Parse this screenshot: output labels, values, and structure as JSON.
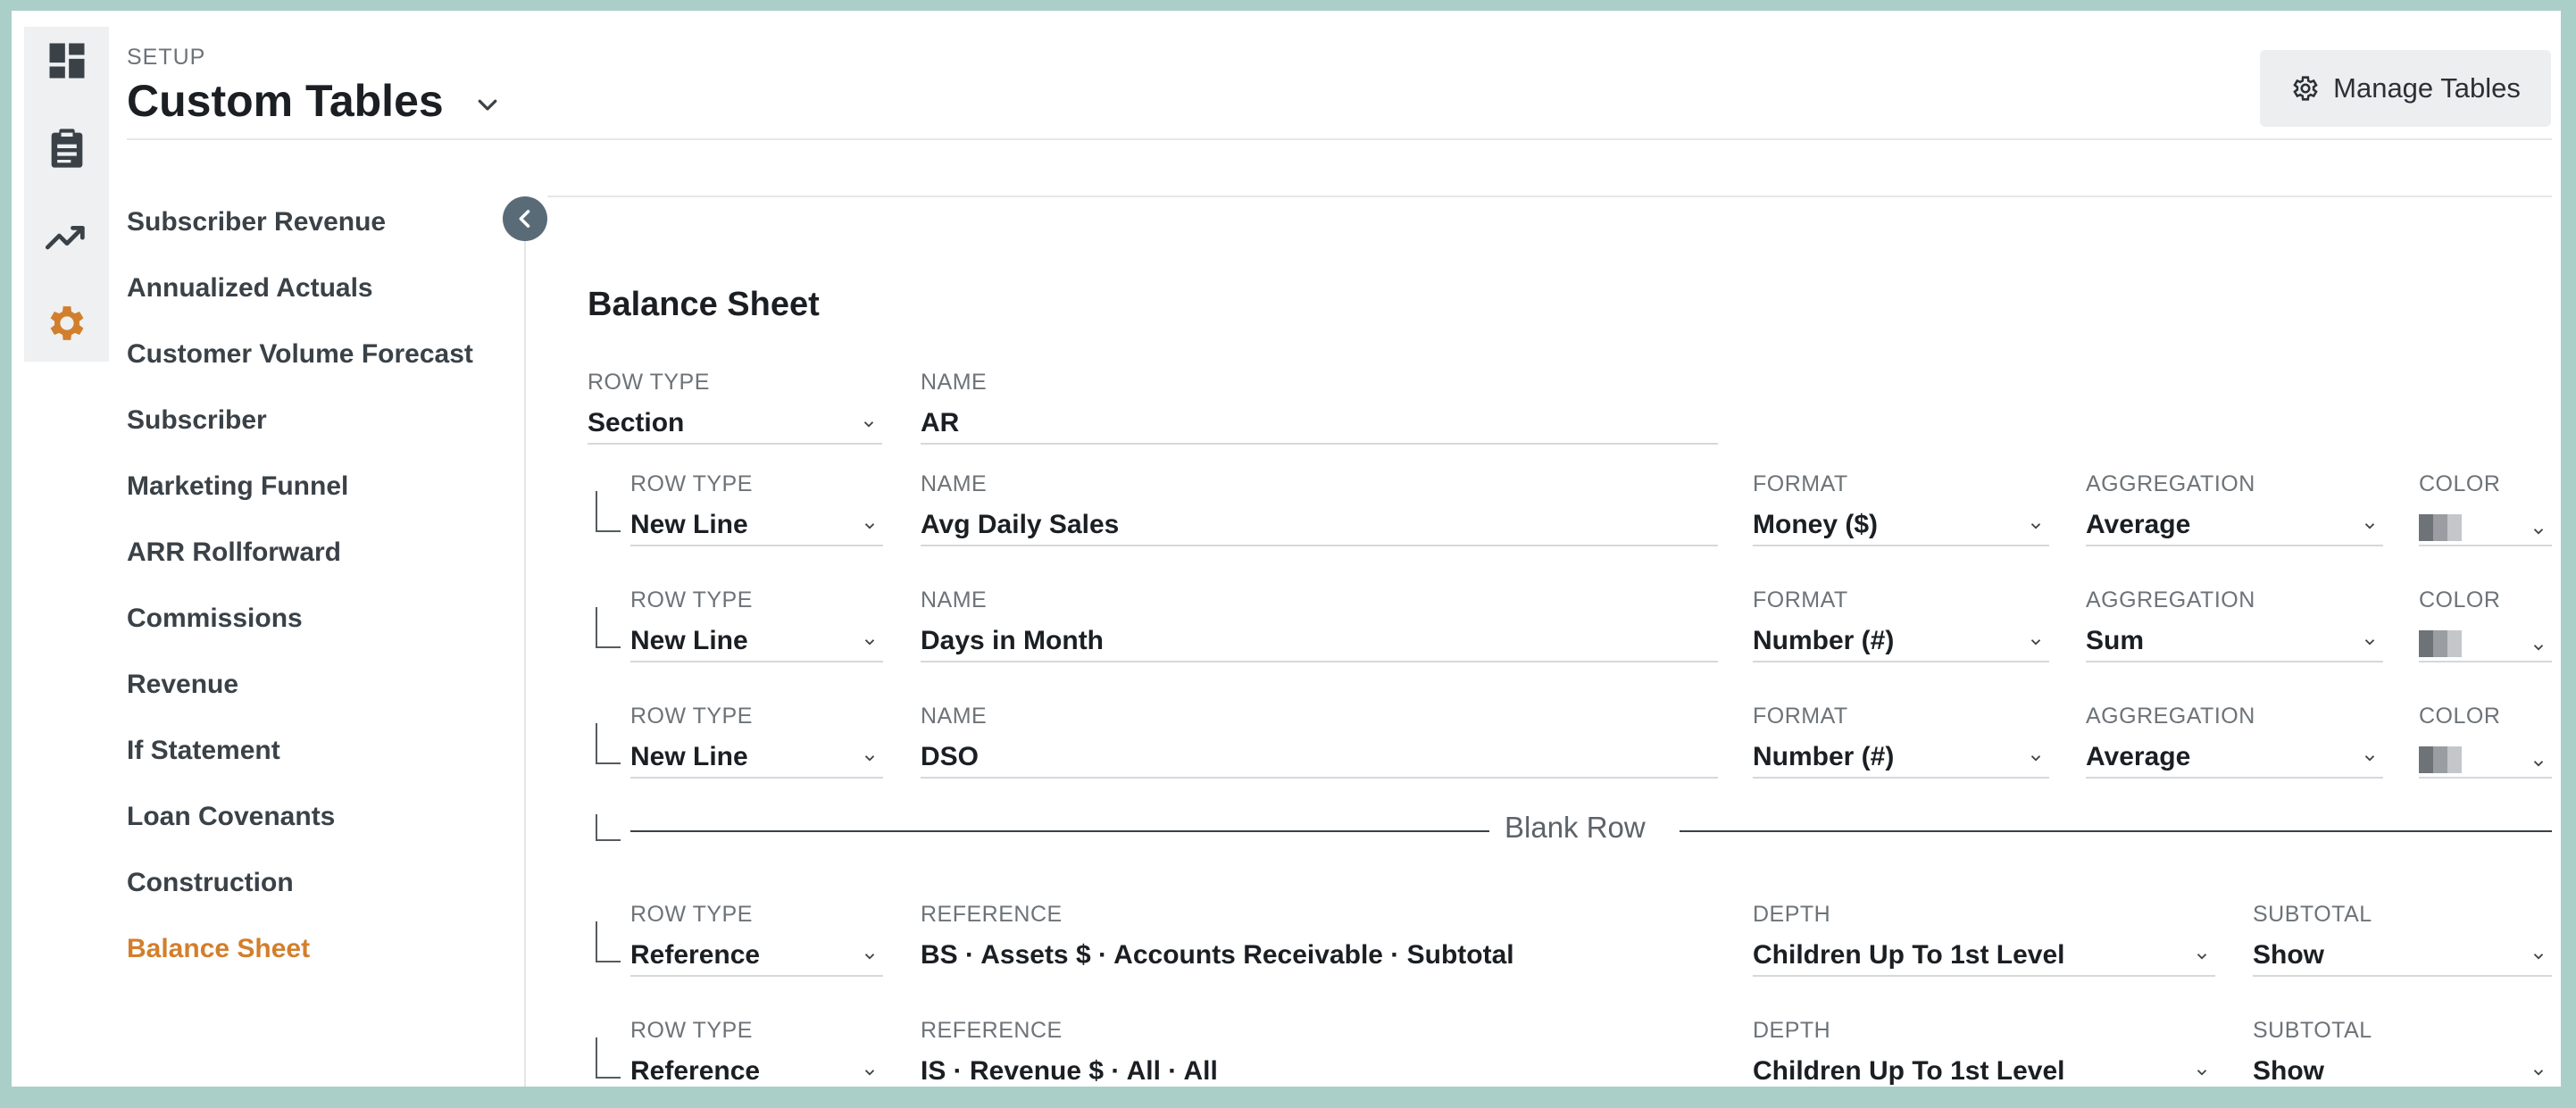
{
  "rail": {
    "icons": [
      "dashboard-icon",
      "clipboard-icon",
      "trend-chart-icon",
      "gear-icon"
    ],
    "active": "gear-icon",
    "active_color": "#d27f2d"
  },
  "header": {
    "eyebrow": "SETUP",
    "title": "Custom Tables",
    "manage_button": "Manage Tables"
  },
  "sidebar": {
    "items": [
      {
        "label": "Subscriber Revenue"
      },
      {
        "label": "Annualized Actuals"
      },
      {
        "label": "Customer Volume Forecast"
      },
      {
        "label": "Subscriber"
      },
      {
        "label": "Marketing Funnel"
      },
      {
        "label": "ARR Rollforward"
      },
      {
        "label": "Commissions"
      },
      {
        "label": "Revenue"
      },
      {
        "label": "If Statement"
      },
      {
        "label": "Loan Covenants"
      },
      {
        "label": "Construction"
      },
      {
        "label": "Balance Sheet"
      }
    ],
    "active_index": 11
  },
  "table": {
    "title": "Balance Sheet",
    "rows": [
      {
        "kind": "section",
        "row_type_label": "ROW TYPE",
        "row_type": "Section",
        "name_label": "NAME",
        "name": "AR"
      },
      {
        "kind": "line",
        "row_type_label": "ROW TYPE",
        "row_type": "New Line",
        "name_label": "NAME",
        "name": "Avg Daily Sales",
        "format_label": "FORMAT",
        "format": "Money ($)",
        "aggregation_label": "AGGREGATION",
        "aggregation": "Average",
        "color_label": "COLOR"
      },
      {
        "kind": "line",
        "row_type_label": "ROW TYPE",
        "row_type": "New Line",
        "name_label": "NAME",
        "name": "Days in Month",
        "format_label": "FORMAT",
        "format": "Number (#)",
        "aggregation_label": "AGGREGATION",
        "aggregation": "Sum",
        "color_label": "COLOR"
      },
      {
        "kind": "line",
        "row_type_label": "ROW TYPE",
        "row_type": "New Line",
        "name_label": "NAME",
        "name": "DSO",
        "format_label": "FORMAT",
        "format": "Number (#)",
        "aggregation_label": "AGGREGATION",
        "aggregation": "Average",
        "color_label": "COLOR"
      },
      {
        "kind": "blank",
        "label": "Blank Row"
      },
      {
        "kind": "reference",
        "row_type_label": "ROW TYPE",
        "row_type": "Reference",
        "reference_label": "REFERENCE",
        "reference": "BS · Assets $ · Accounts Receivable · Subtotal",
        "depth_label": "DEPTH",
        "depth": "Children Up To 1st Level",
        "subtotal_label": "SUBTOTAL",
        "subtotal": "Show"
      },
      {
        "kind": "reference",
        "row_type_label": "ROW TYPE",
        "row_type": "Reference",
        "reference_label": "REFERENCE",
        "reference": "IS · Revenue $ · All · All",
        "depth_label": "DEPTH",
        "depth": "Children Up To 1st Level",
        "subtotal_label": "SUBTOTAL",
        "subtotal": "Show"
      }
    ],
    "swatch_colors": [
      "#6e7378",
      "#9a9ea2",
      "#c4c7ca"
    ]
  }
}
